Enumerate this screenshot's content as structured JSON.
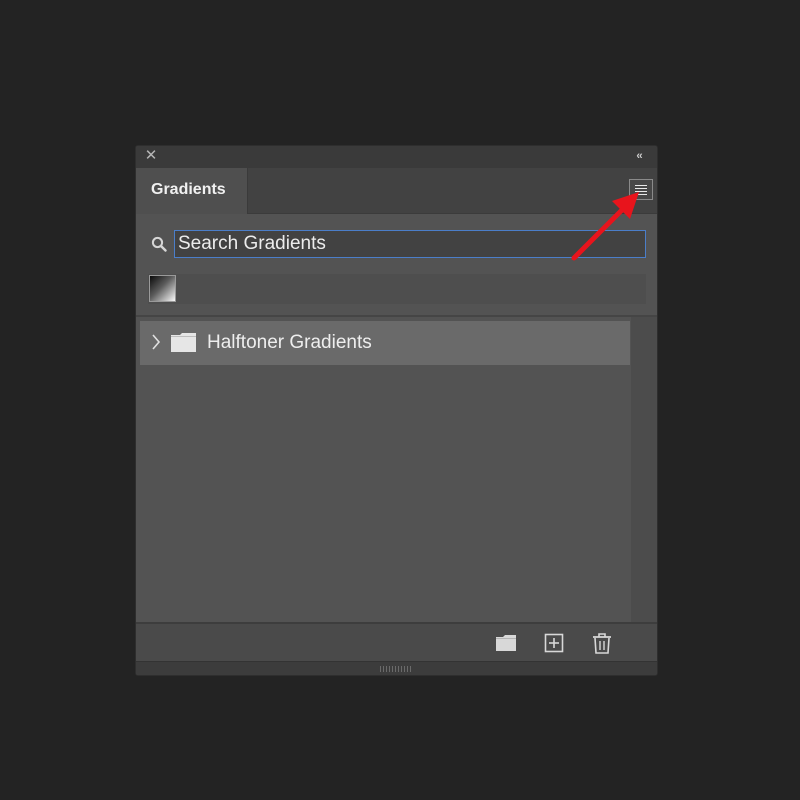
{
  "panel": {
    "tab_label": "Gradients",
    "close_icon_glyph": "✕",
    "collapse_icon_glyph": "‹‹"
  },
  "search": {
    "value": "Search Gradients"
  },
  "recent": {
    "swatch_colors": [
      "#0a0a0a",
      "#fafafa"
    ]
  },
  "list": {
    "items": [
      {
        "label": "Halftoner Gradients",
        "type": "folder",
        "expanded": false
      }
    ]
  },
  "footer": {
    "buttons": [
      "new-group-icon",
      "new-gradient-icon",
      "delete-icon"
    ]
  },
  "annotation": {
    "arrow_color": "#e8141c",
    "points_to": "panel-menu-button"
  },
  "colors": {
    "background": "#232323",
    "panel": "#535353",
    "selected_row": "#6a6a6a",
    "focus_border": "#4b7ec9"
  }
}
